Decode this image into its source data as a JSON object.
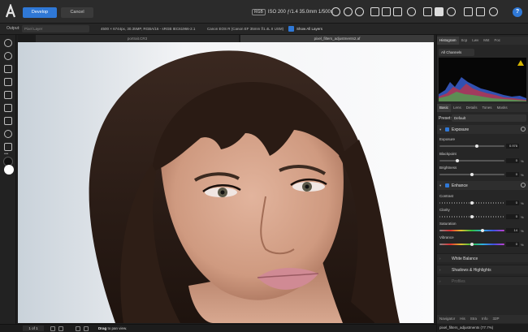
{
  "header": {
    "develop_label": "Develop",
    "cancel_label": "Cancel",
    "color_mode": "RGB",
    "exif": "ISO 200 ƒ/1.4 35.0mm 1/500s",
    "help_label": "?"
  },
  "context_bar": {
    "output_label": "Output:",
    "output_value": "Pixel Layer",
    "image_info": "4500 × 6744px, 30.35MP, RGBA/16 - sRGB IEC61966-2.1",
    "camera_info": "Canon EOS R (Canon EF 35mm f/1.4L II USM)",
    "show_all_layers_label": "Show All Layers"
  },
  "document_tabs": {
    "tab1": "portrait.CR3",
    "tab2": "pixel_filters_adjustments2.af"
  },
  "toolbar": {
    "more_label": "•••"
  },
  "status_bar": {
    "page": "1 of 1",
    "drag_bold": "Drag",
    "drag_hint": "to pan view."
  },
  "panel": {
    "top_tabs": [
      "Histogram",
      "Scp",
      "Lwv",
      "Mst",
      "Foc"
    ],
    "channel_select": "All Channels",
    "basic_tabs": [
      "Basic",
      "Lens",
      "Details",
      "Tones",
      "Masks"
    ],
    "preset_label": "Preset:",
    "preset_value": "Default",
    "exposure_section": {
      "title": "Exposure",
      "rows": [
        {
          "label": "Exposure",
          "value": "0.976",
          "unit": "",
          "level": 0.58
        },
        {
          "label": "Blackpoint",
          "value": "0",
          "unit": "%",
          "level": 0.28
        },
        {
          "label": "Brightness",
          "value": "0",
          "unit": "%",
          "level": 0.5
        }
      ]
    },
    "enhance_section": {
      "title": "Enhance",
      "rows": [
        {
          "label": "Contrast",
          "value": "0",
          "unit": "%",
          "level": 0.5
        },
        {
          "label": "Clarity",
          "value": "0",
          "unit": "%",
          "level": 0.5
        },
        {
          "label": "Saturation",
          "value": "14",
          "unit": "%",
          "level": 0.66
        },
        {
          "label": "Vibrance",
          "value": "0",
          "unit": "%",
          "level": 0.5
        }
      ]
    },
    "collapsed_sections": [
      "White Balance",
      "Shadows & Highlights",
      "Profiles"
    ],
    "bottom_tabs": [
      "Navigator",
      "His",
      "Stra",
      "Info",
      "32P"
    ],
    "footer_label": "pixel_filters_adjustments (77.7%)"
  },
  "colors": {
    "accent": "#2f78d6",
    "warning": "#d4b400"
  }
}
